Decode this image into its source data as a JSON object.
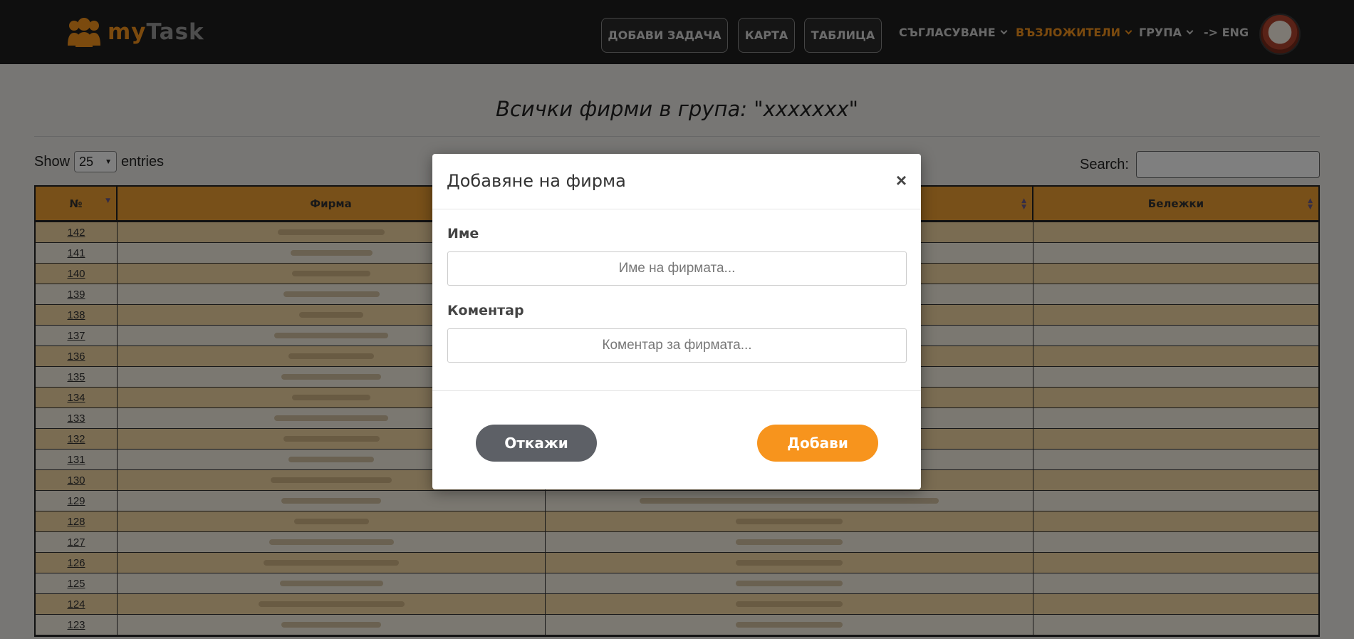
{
  "brand": {
    "my": "my",
    "task": "Task"
  },
  "nav": {
    "add_task": "ДОБАВИ ЗАДАЧА",
    "map": "КАРТА",
    "table": "ТАБЛИЦА",
    "approval": "СЪГЛАСУВАНЕ",
    "assigners": "ВЪЗЛОЖИТЕЛИ",
    "group": "ГРУПА",
    "lang": "-> ENG"
  },
  "page": {
    "title": "Всички фирми в група: \"xxxxxxx\"",
    "show_label": "Show",
    "entries_label": "entries",
    "page_size": "25",
    "search_label": "Search:"
  },
  "table": {
    "headers": {
      "num": "№",
      "company": "Фирма",
      "notes": "Бележки"
    },
    "rows": [
      {
        "n": "142"
      },
      {
        "n": "141"
      },
      {
        "n": "140"
      },
      {
        "n": "139"
      },
      {
        "n": "138"
      },
      {
        "n": "137"
      },
      {
        "n": "136"
      },
      {
        "n": "135"
      },
      {
        "n": "134"
      },
      {
        "n": "133"
      },
      {
        "n": "132"
      },
      {
        "n": "131"
      },
      {
        "n": "130"
      },
      {
        "n": "129"
      },
      {
        "n": "128"
      },
      {
        "n": "127"
      },
      {
        "n": "126"
      },
      {
        "n": "125"
      },
      {
        "n": "124"
      },
      {
        "n": "123"
      }
    ]
  },
  "modal": {
    "title": "Добавяне на фирма",
    "close": "×",
    "name_label": "Име",
    "name_placeholder": "Име на фирмата...",
    "comment_label": "Коментар",
    "comment_placeholder": "Коментар за фирмата...",
    "cancel": "Откажи",
    "add": "Добави"
  },
  "colors": {
    "accent": "#f7941d",
    "navbar": "#1f1f1f",
    "header_row": "#f0a033"
  }
}
